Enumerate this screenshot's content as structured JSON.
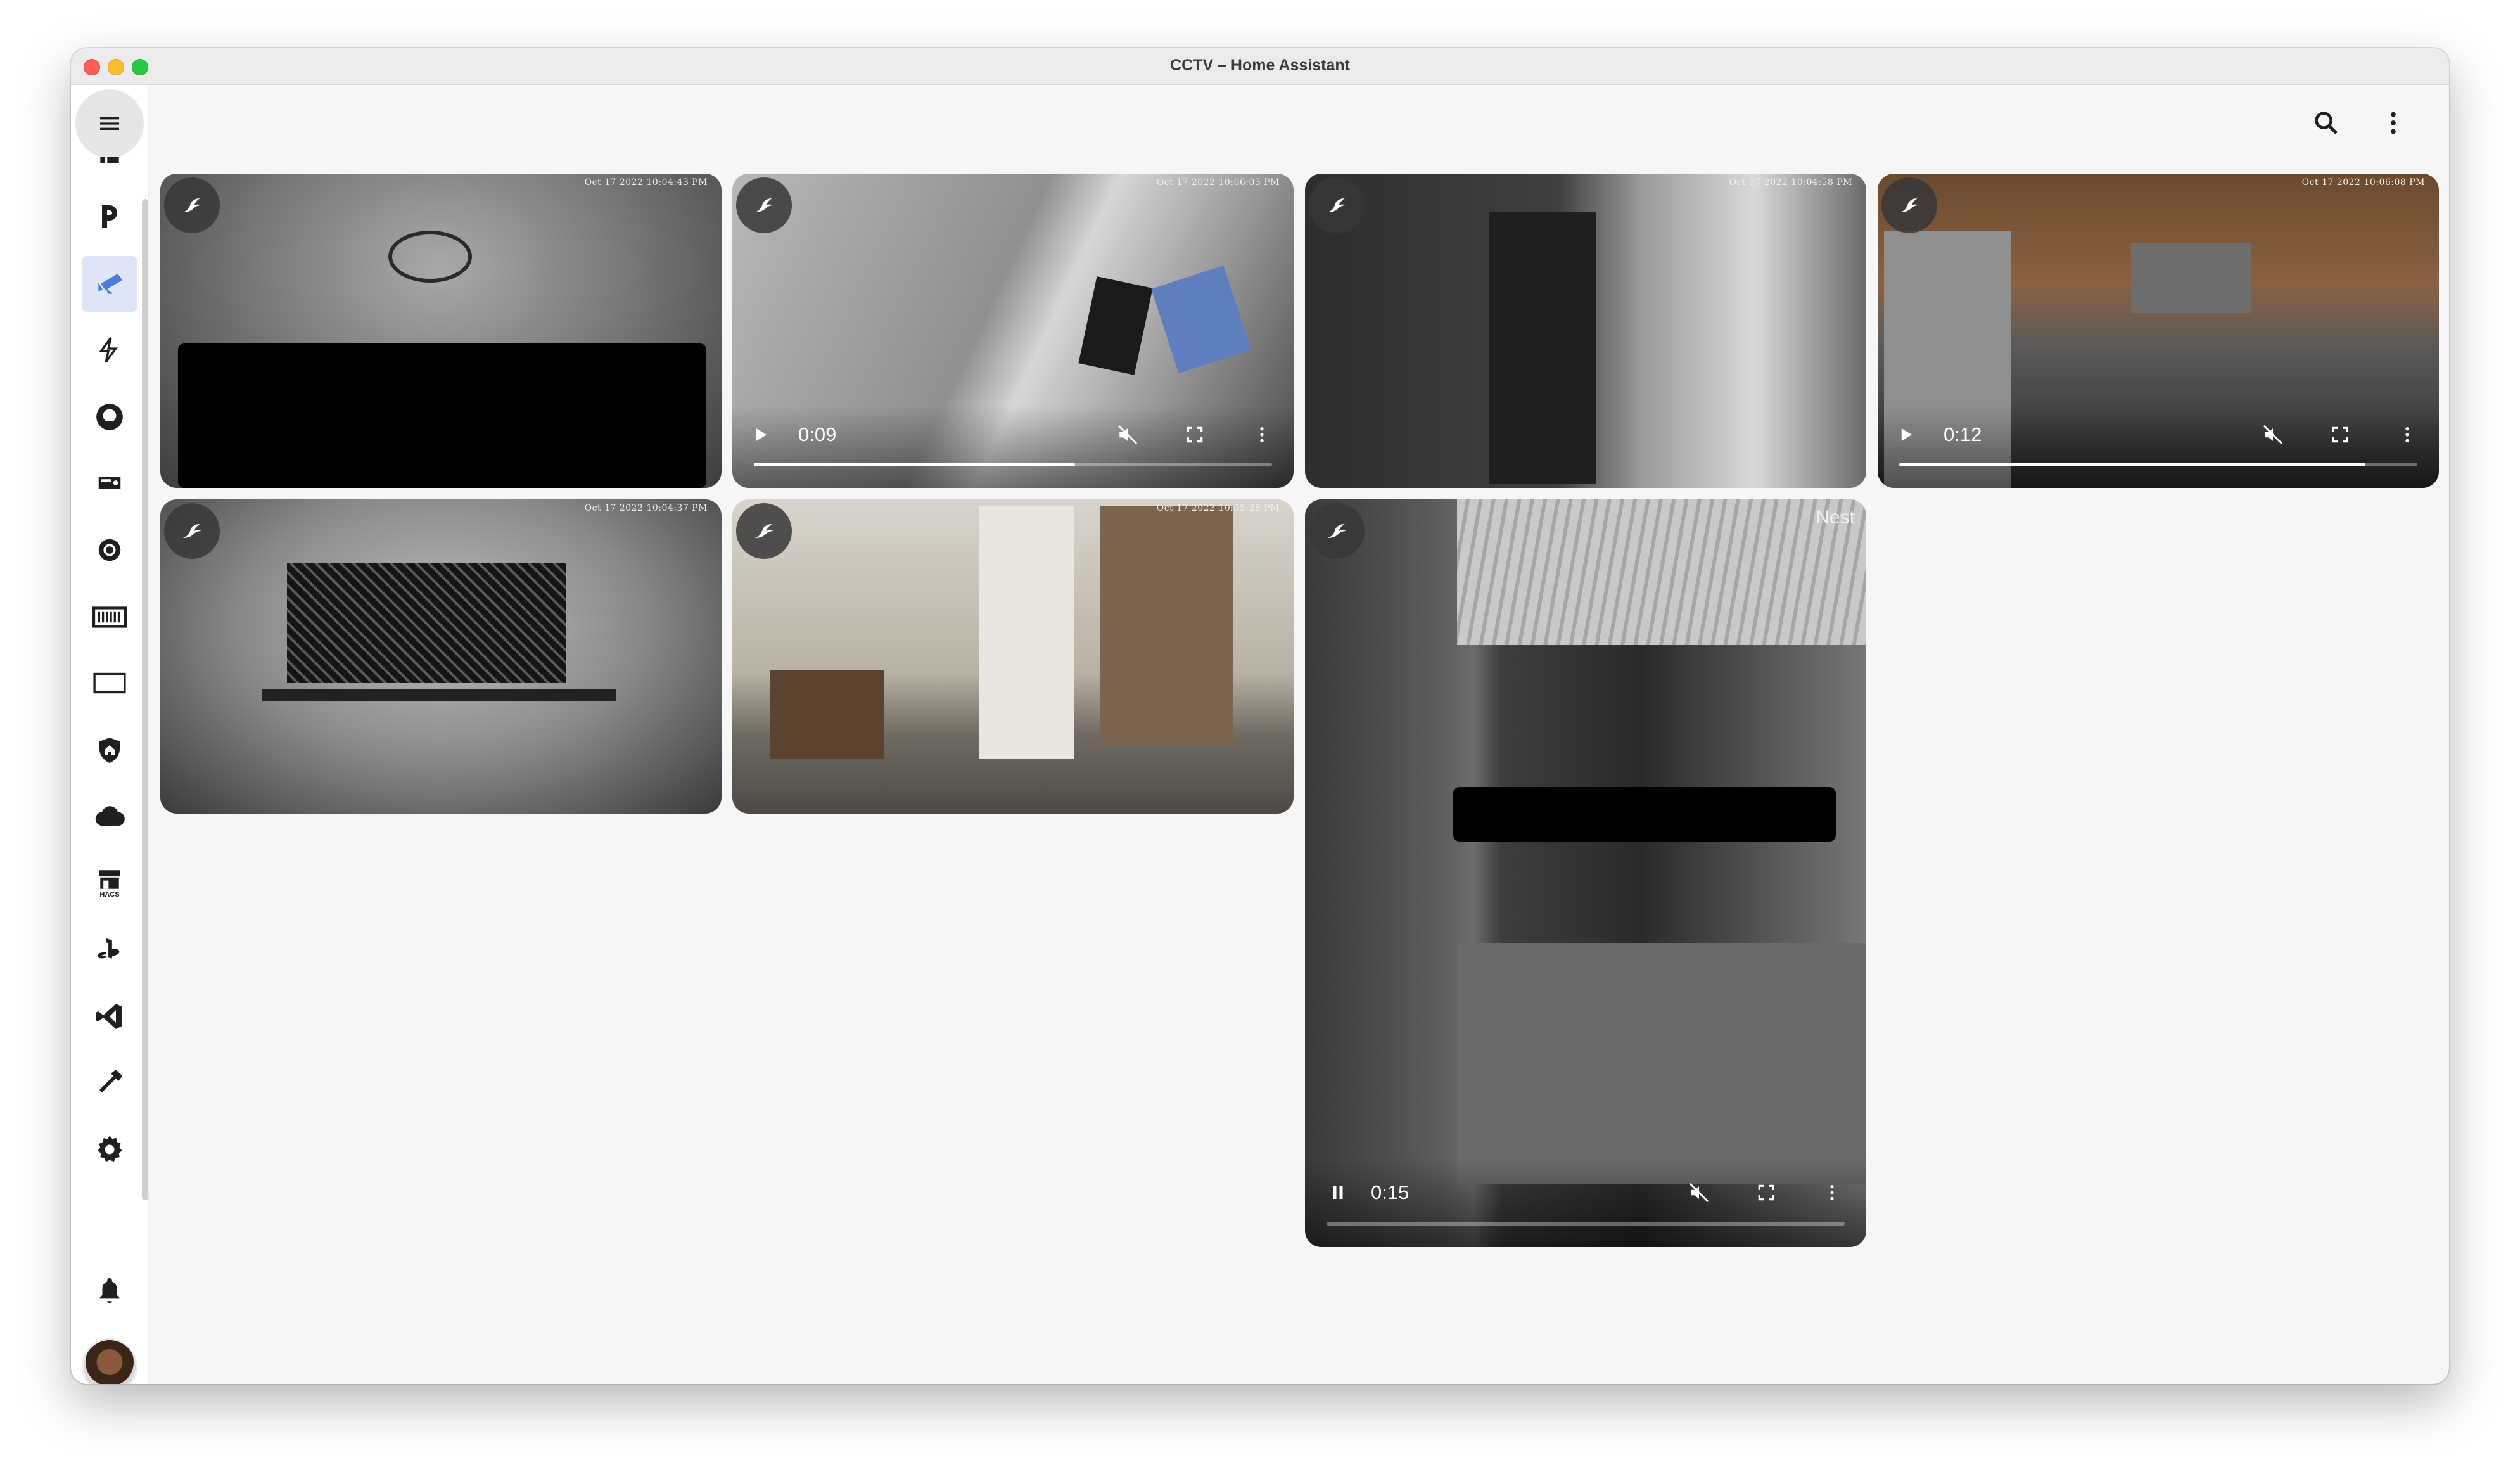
{
  "window": {
    "title": "CCTV – Home Assistant"
  },
  "sidebar": {
    "items": [
      {
        "icon": "partial-top-icon"
      },
      {
        "icon": "plex-icon"
      },
      {
        "icon": "cctv-icon",
        "active": true
      },
      {
        "icon": "lightning-icon"
      },
      {
        "icon": "github-icon"
      },
      {
        "icon": "media-player-icon"
      },
      {
        "icon": "record-icon"
      },
      {
        "icon": "keyboard-icon"
      },
      {
        "icon": "monitor-icon"
      },
      {
        "icon": "shield-home-icon"
      },
      {
        "icon": "cloud-icon"
      },
      {
        "icon": "hacs-icon",
        "label": "HACS"
      },
      {
        "icon": "playstation-icon"
      },
      {
        "icon": "vscode-icon"
      },
      {
        "icon": "hammer-icon"
      },
      {
        "icon": "settings-icon"
      }
    ],
    "bottom": {
      "notifications_icon": "bell-icon",
      "avatar": "user-avatar"
    }
  },
  "toolbar": {
    "search_icon": "search-icon",
    "more_icon": "dots-vertical-icon"
  },
  "cameras": [
    {
      "timestamp": "Oct 17 2022  10:04:43 PM",
      "type": "still"
    },
    {
      "timestamp": "Oct 17 2022  10:06:03 PM",
      "type": "video",
      "time": "0:09",
      "progress": 0.62
    },
    {
      "timestamp": "Oct 17 2022  10:04:58 PM",
      "type": "still"
    },
    {
      "timestamp": "Oct 17 2022  10:06:08 PM",
      "type": "video",
      "time": "0:12",
      "progress": 0.9
    },
    {
      "timestamp": "Oct 17 2022  10:04:37 PM",
      "type": "still"
    },
    {
      "timestamp": "Oct 17 2022  10:05:28 PM",
      "type": "still"
    },
    {
      "label": "Nest",
      "type": "video",
      "time": "0:15",
      "progress": 0.0,
      "playing": true
    }
  ],
  "colors": {
    "accent": "#4d7bd6",
    "icon": "#1f1f1f"
  }
}
